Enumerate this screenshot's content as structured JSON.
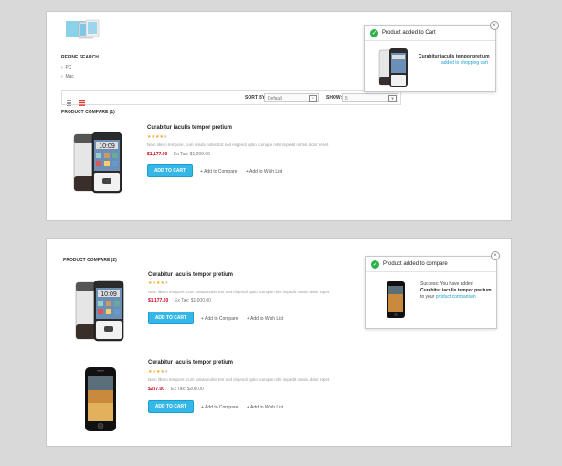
{
  "top": {
    "refine_title": "REFINE SEARCH",
    "refine_items": [
      "PC",
      "Mac"
    ],
    "sort_label": "SORT BY:",
    "sort_value": "Default",
    "show_label": "SHOW:",
    "show_value": "5",
    "compare_label": "PRODUCT COMPARE (1)",
    "product": {
      "title": "Curabitur iaculis tempor pretium",
      "rating": 4,
      "desc": "Nam libero tempore, cum soluta nobis Est sed eligendi optio cumque nihil impedit omnis dolor repet.",
      "price": "$1,177.00",
      "extax": "Ex Tax: $1,000.00",
      "add_to_cart": "ADD TO CART",
      "compare": "+ Add to Compare",
      "wishlist": "+ Add to Wish List"
    },
    "popup": {
      "header": "Product added to Cart",
      "product_name": "Curabitur iaculis tempor pretium",
      "suffix": "added to shopping cart",
      "close": "×"
    }
  },
  "bottom": {
    "compare_label": "PRODUCT COMPARE (2)",
    "products": [
      {
        "title": "Curabitur iaculis tempor pretium",
        "rating": 4,
        "desc": "Nam libero tempore, cum soluta nobis Est sed eligendi optio cumque nihil impedit omnis dolor repet.",
        "price": "$1,177.00",
        "extax": "Ex Tax: $1,000.00",
        "add_to_cart": "ADD TO CART",
        "compare": "+ Add to Compare",
        "wishlist": "+ Add to Wish List"
      },
      {
        "title": "Curabitur iaculis tempor pretium",
        "rating": 4,
        "desc": "Nam libero tempore, cum soluta nobis Est sed eligendi optio cumque nihil impedit omnis dolor repet.",
        "price": "$237.00",
        "extax": "Ex Tax: $200.00",
        "add_to_cart": "ADD TO CART",
        "compare": "+ Add to Compare",
        "wishlist": "+ Add to Wish List"
      }
    ],
    "popup": {
      "header": "Product added to compare",
      "line1": "Success: You have added",
      "product_name": "Curabitur iaculis tempor pretium",
      "line3a": "to your",
      "link": "product comparison",
      "close": "×"
    }
  },
  "colors": {
    "accent": "#35b8e8",
    "price": "#d0021b",
    "success": "#2bb34b",
    "star": "#f5a623"
  }
}
